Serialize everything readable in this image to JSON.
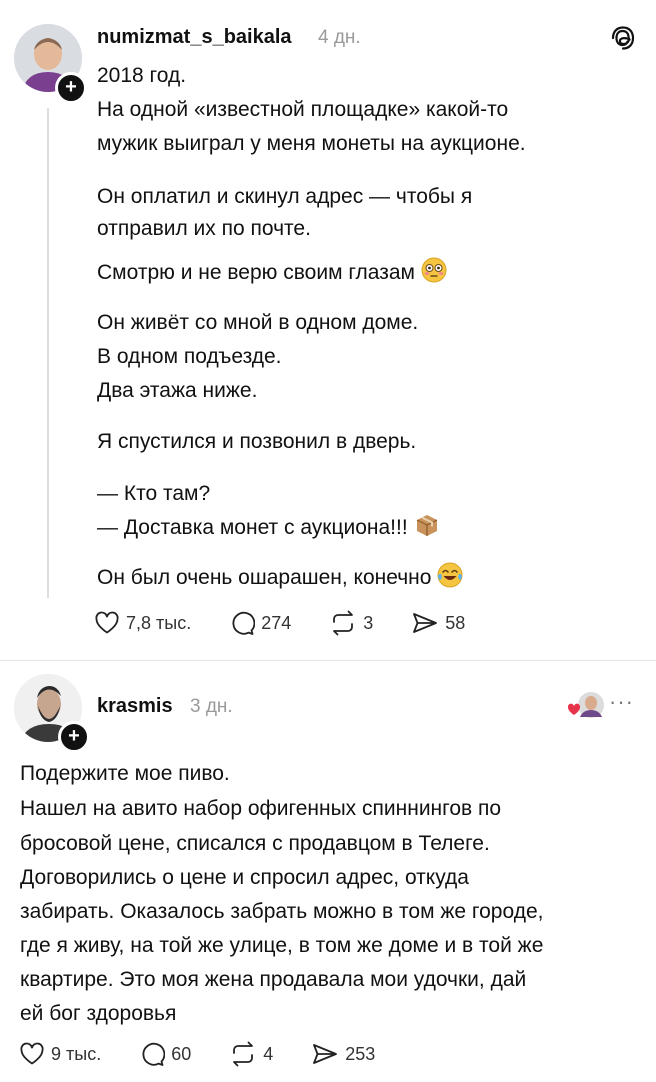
{
  "post1": {
    "username": "numizmat_s_baikala",
    "time": "4 дн.",
    "lines": [
      "2018 год.",
      "На одной «известной площадке» какой-то",
      "мужик выиграл у меня монеты на аукционе.",
      "Он оплатил и скинул адрес — чтобы я",
      "отправил их по почте.",
      "Смотрю и не верю своим глазам",
      "Он живёт со мной в одном доме.",
      "В одном подъезде.",
      "Два этажа ниже.",
      "Я спустился и позвонил в дверь.",
      "— Кто там?",
      "— Доставка монет с аукциона!!!",
      "Он был очень ошарашен, конечно"
    ],
    "emojis": [
      "flushed-face-emoji",
      "package-emoji",
      "tears-of-joy-emoji"
    ],
    "likes": "7,8 тыс.",
    "replies": "274",
    "reposts": "3",
    "shares": "58"
  },
  "post2": {
    "username": "krasmis",
    "time": "3 дн.",
    "lines": [
      "Подержите мое пиво.",
      "Нашел на авито набор офигенных спиннингов по",
      "бросовой цене, списался с продавцом в Телеге.",
      "Договорились о цене и спросил адрес, откуда",
      "забирать. Оказалось забрать можно в том же городе,",
      "где я живу, на той же улице, в том же доме и в той же",
      "квартире. Это моя жена продавала мои удочки, дай",
      "ей бог здоровья"
    ],
    "likes": "9 тыс.",
    "replies": "60",
    "reposts": "4",
    "shares": "253",
    "more": "···"
  },
  "icons": {
    "like": "heart-icon",
    "reply": "speech-bubble-icon",
    "repost": "repost-icon",
    "share": "send-icon",
    "app": "threads-logo-icon"
  }
}
